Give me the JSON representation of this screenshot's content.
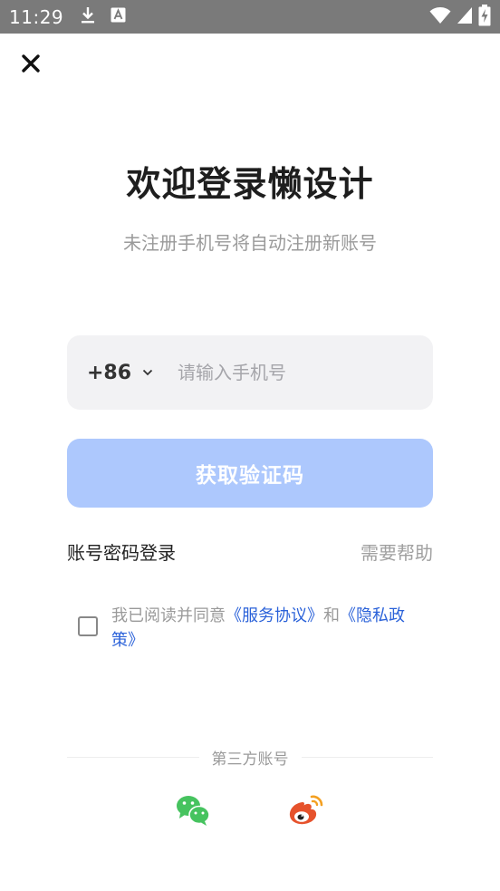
{
  "status_bar": {
    "time": "11:29",
    "icons": [
      "download-icon",
      "text-a-icon",
      "wifi-icon",
      "signal-icon",
      "battery-charging-icon"
    ]
  },
  "header": {
    "close_icon": "close-icon",
    "title": "欢迎登录懒设计",
    "subtitle": "未注册手机号将自动注册新账号"
  },
  "phone": {
    "country_code": "+86",
    "caret_icon": "chevron-down-icon",
    "value": "",
    "placeholder": "请输入手机号"
  },
  "get_code_label": "获取验证码",
  "password_login_label": "账号密码登录",
  "need_help_label": "需要帮助",
  "agreement": {
    "checked": false,
    "prefix": "我已阅读并同意",
    "service_link": "《服务协议》",
    "and": "和",
    "privacy_link": "《隐私政策》"
  },
  "third_party": {
    "label": "第三方账号",
    "wechat_icon": "wechat-icon",
    "weibo_icon": "weibo-icon"
  },
  "colors": {
    "primary_disabled": "#adc8fd",
    "link": "#2b62d9",
    "status_bar": "#7a7a7a",
    "wechat": "#46c35f",
    "weibo": "#e6522c"
  }
}
